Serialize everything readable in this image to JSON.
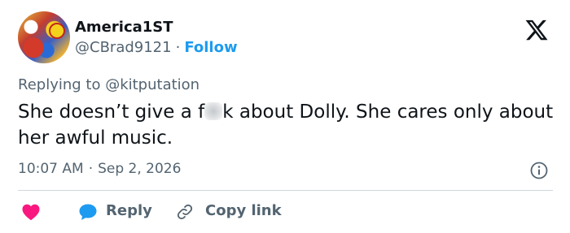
{
  "author": {
    "display_name": "America1ST",
    "handle": "@CBrad9121",
    "follow_label": "Follow",
    "separator": "·"
  },
  "reply_context": {
    "prefix": "Replying to ",
    "mention": "@kitputation"
  },
  "tweet": {
    "text_before": "She doesn’t give a f",
    "text_after": "k about Dolly. She cares only about her awful music."
  },
  "meta": {
    "time": "10:07 AM",
    "separator": "·",
    "date": "Sep 2, 2026"
  },
  "actions": {
    "reply_label": "Reply",
    "copy_link_label": "Copy link"
  },
  "icons": {
    "logo": "x-logo-icon",
    "info": "info-icon",
    "like": "heart-icon",
    "reply": "speech-bubble-icon",
    "copy": "link-icon"
  },
  "colors": {
    "text": "#0f1419",
    "secondary": "#536471",
    "accent": "#1d9bf0",
    "heart": "#f91880",
    "divider": "#cfd9de"
  }
}
